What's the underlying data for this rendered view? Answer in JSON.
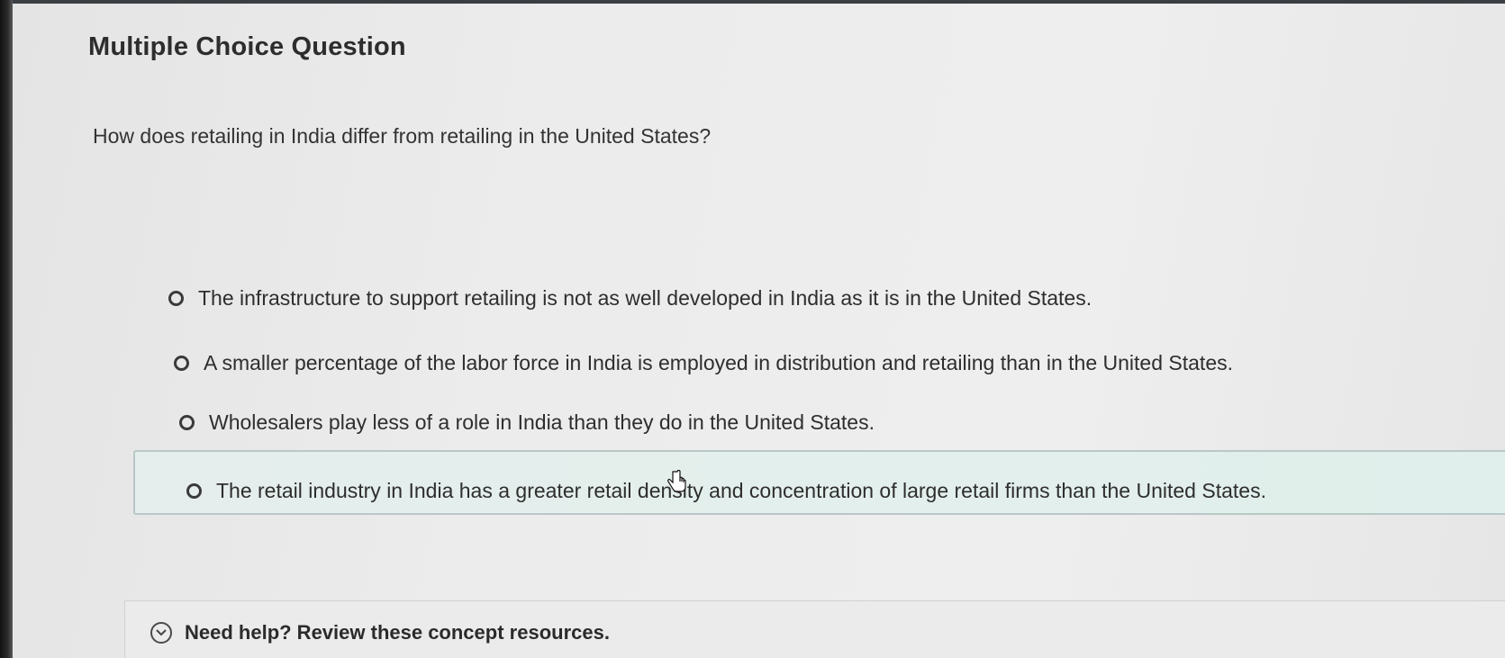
{
  "question": {
    "type_label": "Multiple Choice Question",
    "prompt": "How does retailing in India differ from retailing in the United States?"
  },
  "options": [
    {
      "text": "The infrastructure to support retailing is not as well developed in India as it is in the United States.",
      "selected": false
    },
    {
      "text": "A smaller percentage of the labor force in India is employed in distribution and retailing than in the United States.",
      "selected": false
    },
    {
      "text": "Wholesalers play less of a role in India than they do in the United States.",
      "selected": false
    },
    {
      "text": "The retail industry in India has a greater retail density and concentration of large retail firms than the United States.",
      "selected": false,
      "hovered": true
    }
  ],
  "help": {
    "label": "Need help? Review these concept resources.",
    "icon": "chevron-down-icon"
  },
  "colors": {
    "hover_background": "#e3efec",
    "hover_border": "#b9c8c6",
    "text": "#2e2e2e"
  }
}
